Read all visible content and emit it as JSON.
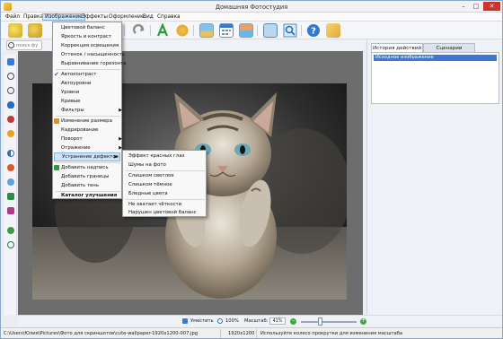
{
  "titlebar": {
    "title": "Домашняя Фотостудия",
    "minimize": "–",
    "maximize": "□",
    "close": "✕"
  },
  "menubar": {
    "items": [
      "Файл",
      "Правка",
      "Изображение",
      "Эффекты",
      "Оформление",
      "Вид",
      "Справка"
    ],
    "active_index": 2
  },
  "search": {
    "placeholder": "поиск фу"
  },
  "image_menu": {
    "items": [
      {
        "label": "Цветовой баланс"
      },
      {
        "label": "Яркость и контраст"
      },
      {
        "label": "Коррекция освещения"
      },
      {
        "label": "Оттенок / насыщенность"
      },
      {
        "label": "Выравнивание горизонта"
      },
      {
        "label": "Автоконтраст",
        "checked": true
      },
      {
        "label": "Автоуровни"
      },
      {
        "label": "Уровни"
      },
      {
        "label": "Кривые"
      },
      {
        "label": "Фильтры",
        "submenu": true
      },
      {
        "label": "Изменение размера"
      },
      {
        "label": "Кадрирование"
      },
      {
        "label": "Поворот",
        "submenu": true
      },
      {
        "label": "Отражение",
        "submenu": true
      },
      {
        "label": "Устранение дефектов",
        "submenu": true,
        "highlighted": true
      },
      {
        "label": "Добавить надпись"
      },
      {
        "label": "Добавить границы"
      },
      {
        "label": "Добавить тень"
      },
      {
        "label": "Каталог улучшения",
        "bold": true
      }
    ]
  },
  "defects_submenu": {
    "items": [
      "Эффект красных глаз",
      "Шумы на фото",
      "Слишком светлое",
      "Слишком тёмное",
      "Бледные цвета",
      "Не хватает чёткости",
      "Нарушен цветовой баланс"
    ]
  },
  "right_panel": {
    "tabs": [
      "История действий",
      "Сценарии"
    ],
    "active_tab": 0,
    "history": [
      "Исходное изображение"
    ]
  },
  "zoom_bar": {
    "fit_label": "Уместить",
    "zoom_100": "100%",
    "scale_label": "Масштаб:",
    "scale_value": "41%",
    "minus": "–",
    "plus": "+",
    "zoom_level": 0.3
  },
  "status_bar": {
    "path": "C:\\Users\\Юлия\\Pictures\\Фото для скриншотов\\cute-wallpaper-1920x1200-007.jpg",
    "size": "1920x1200",
    "hint": "Используйте колесо прокрутки для изменения масштаба"
  },
  "colors": {
    "accent": "#3b78d8",
    "menu_highlight": "#cfe3f8",
    "close": "#c7352d"
  },
  "toolbar_icons": [
    "open-icon",
    "save-icon",
    "print-icon",
    "undo-icon",
    "redo-icon",
    "text-icon",
    "palette-icon",
    "landscape-icon",
    "calendar-icon",
    "collage-icon",
    "frame-icon",
    "zoom-icon",
    "help-icon",
    "box-icon"
  ]
}
